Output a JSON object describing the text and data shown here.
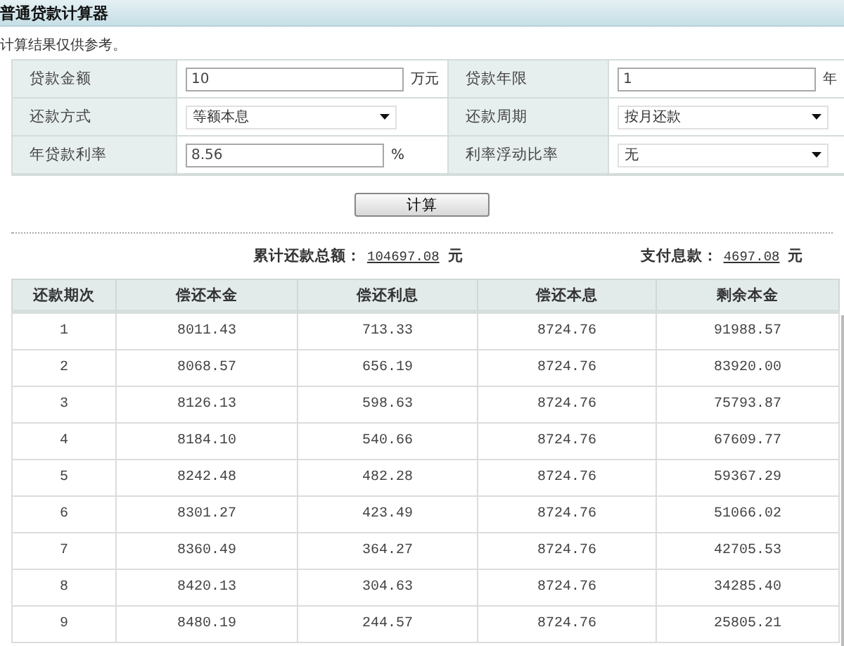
{
  "title": "普通贷款计算器",
  "note": "计算结果仅供参考。",
  "form_rows": [
    [
      {
        "label": "贷款金额",
        "kind": "text",
        "value": "10",
        "unit": "万元"
      },
      {
        "label": "贷款年限",
        "kind": "text",
        "value": "1",
        "unit": "年"
      }
    ],
    [
      {
        "label": "还款方式",
        "kind": "select",
        "value": "等额本息"
      },
      {
        "label": "还款周期",
        "kind": "select",
        "value": "按月还款"
      }
    ],
    [
      {
        "label": "年贷款利率",
        "kind": "text",
        "value": "8.56",
        "unit": "%"
      },
      {
        "label": "利率浮动比率",
        "kind": "select",
        "value": "无"
      }
    ]
  ],
  "calculate_button": "计算",
  "summary": [
    {
      "label": "累计还款总额：",
      "value": "104697.08",
      "unit": "元"
    },
    {
      "label": "支付息款：",
      "value": "4697.08",
      "unit": "元"
    }
  ],
  "table": {
    "columns": [
      "还款期次",
      "偿还本金",
      "偿还利息",
      "偿还本息",
      "剩余本金"
    ],
    "rows": [
      [
        "1",
        "8011.43",
        "713.33",
        "8724.76",
        "91988.57"
      ],
      [
        "2",
        "8068.57",
        "656.19",
        "8724.76",
        "83920.00"
      ],
      [
        "3",
        "8126.13",
        "598.63",
        "8724.76",
        "75793.87"
      ],
      [
        "4",
        "8184.10",
        "540.66",
        "8724.76",
        "67609.77"
      ],
      [
        "5",
        "8242.48",
        "482.28",
        "8724.76",
        "59367.29"
      ],
      [
        "6",
        "8301.27",
        "423.49",
        "8724.76",
        "51066.02"
      ],
      [
        "7",
        "8360.49",
        "364.27",
        "8724.76",
        "42705.53"
      ],
      [
        "8",
        "8420.13",
        "304.63",
        "8724.76",
        "34285.40"
      ],
      [
        "9",
        "8480.19",
        "244.57",
        "8724.76",
        "25805.21"
      ]
    ]
  }
}
